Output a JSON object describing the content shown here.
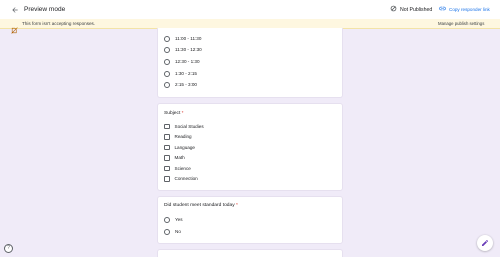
{
  "header": {
    "title": "Preview mode",
    "not_published_label": "Not Published",
    "copy_link_label": "Copy responder link"
  },
  "banner": {
    "message": "This form isn't accepting responses.",
    "manage_label": "Manage publish settings"
  },
  "time_question": {
    "options": [
      "11:00 - 11:30",
      "11:30 - 12:30",
      "12:30 - 1:30",
      "1:30 - 2:15",
      "2:15 - 3:00"
    ]
  },
  "subject_question": {
    "title": "Subject",
    "required_mark": "*",
    "options": [
      "Social Studies",
      "Reading",
      "Language",
      "Math",
      "Science",
      "Connection"
    ]
  },
  "standard_question": {
    "title": "Did student meet standard today",
    "required_mark": "*",
    "options": [
      "Yes",
      "No"
    ]
  },
  "help": {
    "label": "?"
  },
  "colors": {
    "background": "#f0ebf8",
    "accent": "#1a73e8",
    "banner": "#fef7e0",
    "required": "#d93025"
  }
}
